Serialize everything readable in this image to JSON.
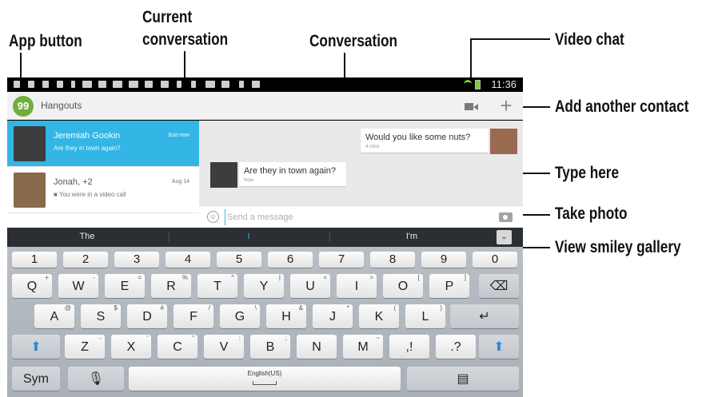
{
  "callouts": {
    "app_button": "App button",
    "current_conversation_1": "Current",
    "current_conversation_2": "conversation",
    "conversation": "Conversation",
    "video_chat": "Video chat",
    "add_another_contact": "Add another contact",
    "type_here": "Type here",
    "take_photo": "Take photo",
    "view_smiley_gallery": "View smiley gallery"
  },
  "status_bar": {
    "time": "11:36"
  },
  "app_bar": {
    "title": "Hangouts",
    "logo_glyph": "99",
    "add_glyph": "+"
  },
  "conversations": [
    {
      "name": "Jeremiah Gookin",
      "preview": "Are they in town again?",
      "time": "Just now",
      "active": true
    },
    {
      "name": "Jonah, +2",
      "preview": "■ You were in a video call",
      "time": "Aug 14",
      "active": false
    }
  ],
  "messages": [
    {
      "text": "Would you like some nuts?",
      "sub": "4 mins",
      "from": "other"
    },
    {
      "text": "Are they in town again?",
      "sub": "Now",
      "from": "self"
    }
  ],
  "composer": {
    "placeholder": "Send a message",
    "smiley_glyph": "☺"
  },
  "suggestions": [
    "The",
    "I",
    "I'm"
  ],
  "suggest_collapse": "⌄",
  "keyboard": {
    "numbers": [
      "1",
      "2",
      "3",
      "4",
      "5",
      "6",
      "7",
      "8",
      "9",
      "0"
    ],
    "row1": [
      {
        "k": "Q",
        "h": "+"
      },
      {
        "k": "W",
        "h": "-"
      },
      {
        "k": "E",
        "h": "="
      },
      {
        "k": "R",
        "h": "%"
      },
      {
        "k": "T",
        "h": "^"
      },
      {
        "k": "Y",
        "h": "|"
      },
      {
        "k": "U",
        "h": "<"
      },
      {
        "k": "I",
        "h": ">"
      },
      {
        "k": "O",
        "h": "["
      },
      {
        "k": "P",
        "h": "]"
      }
    ],
    "row2": [
      {
        "k": "A",
        "h": "@"
      },
      {
        "k": "S",
        "h": "$"
      },
      {
        "k": "D",
        "h": "#"
      },
      {
        "k": "F",
        "h": "/"
      },
      {
        "k": "G",
        "h": "\\"
      },
      {
        "k": "H",
        "h": "&"
      },
      {
        "k": "J",
        "h": "*"
      },
      {
        "k": "K",
        "h": "("
      },
      {
        "k": "L",
        "h": ")"
      }
    ],
    "row3": [
      {
        "k": "Z",
        "h": "-"
      },
      {
        "k": "X",
        "h": "'"
      },
      {
        "k": "C",
        "h": "\""
      },
      {
        "k": "V",
        "h": ":"
      },
      {
        "k": "B",
        "h": ";"
      },
      {
        "k": "N",
        "h": ""
      },
      {
        "k": "M",
        "h": "~"
      },
      {
        "k": ",!",
        "h": ""
      },
      {
        "k": ".?",
        "h": ""
      }
    ],
    "backspace": "⌫",
    "enter": "↵",
    "shift": "⬆",
    "sym": "Sym",
    "voice": "🎙",
    "space_label": "English(US)",
    "clipboard": "▤"
  }
}
